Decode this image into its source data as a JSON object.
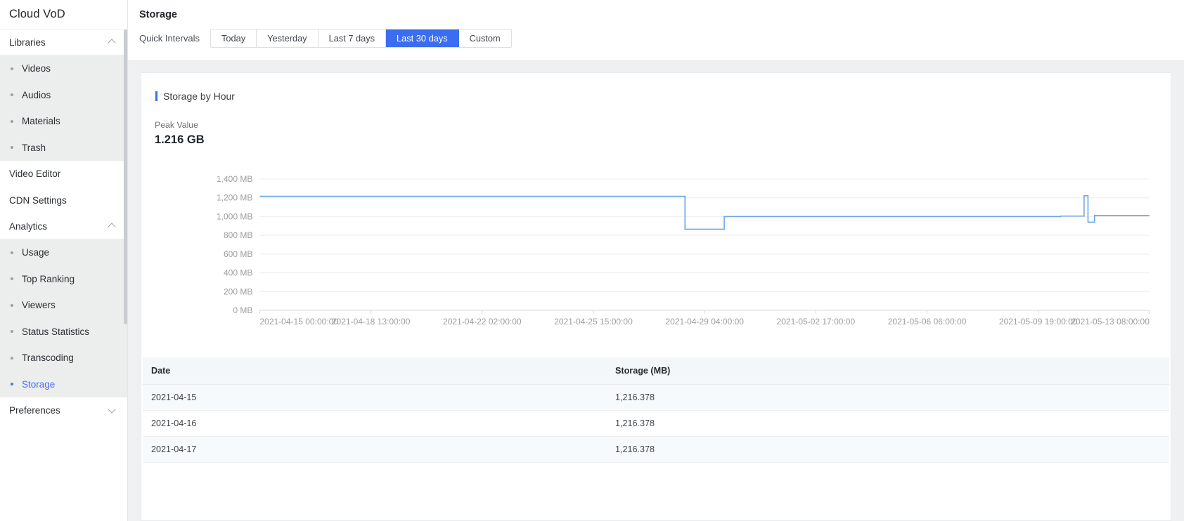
{
  "sidebar": {
    "brand": "Cloud VoD",
    "groups": [
      {
        "label": "Libraries",
        "icon": "chevron-up-icon",
        "expanded": true,
        "items": [
          {
            "label": "Videos",
            "active": false
          },
          {
            "label": "Audios",
            "active": false
          },
          {
            "label": "Materials",
            "active": false
          },
          {
            "label": "Trash",
            "active": false
          }
        ]
      }
    ],
    "plain_items": [
      {
        "label": "Video Editor"
      },
      {
        "label": "CDN Settings"
      }
    ],
    "analytics": {
      "label": "Analytics",
      "icon": "chevron-up-icon",
      "expanded": true,
      "items": [
        {
          "label": "Usage",
          "active": false
        },
        {
          "label": "Top Ranking",
          "active": false
        },
        {
          "label": "Viewers",
          "active": false
        },
        {
          "label": "Status Statistics",
          "active": false
        },
        {
          "label": "Transcoding",
          "active": false
        },
        {
          "label": "Storage",
          "active": true
        }
      ]
    },
    "preferences": {
      "label": "Preferences",
      "icon": "chevron-down-icon",
      "expanded": false
    }
  },
  "header": {
    "title": "Storage",
    "interval_label": "Quick Intervals",
    "intervals": [
      {
        "label": "Today",
        "active": false
      },
      {
        "label": "Yesterday",
        "active": false
      },
      {
        "label": "Last 7 days",
        "active": false
      },
      {
        "label": "Last 30 days",
        "active": true
      },
      {
        "label": "Custom",
        "active": false
      }
    ]
  },
  "card": {
    "title": "Storage by Hour",
    "peak_label": "Peak Value",
    "peak_value": "1.216 GB"
  },
  "colors": {
    "accent": "#3a6df0",
    "line": "#6ba5e8",
    "grid": "#ececec",
    "axis_text": "#9a9da1"
  },
  "chart_data": {
    "type": "line",
    "title": "Storage by Hour",
    "xlabel": "",
    "ylabel": "",
    "ylim": [
      0,
      1400
    ],
    "grid": true,
    "legend": "none",
    "y_ticks": [
      "0 MB",
      "200 MB",
      "400 MB",
      "600 MB",
      "800 MB",
      "1,000 MB",
      "1,200 MB",
      "1,400 MB"
    ],
    "y_tick_values": [
      0,
      200,
      400,
      600,
      800,
      1000,
      1200,
      1400
    ],
    "x_ticks": [
      "2021-04-15 00:00:00",
      "2021-04-18 13:00:00",
      "2021-04-22 02:00:00",
      "2021-04-25 15:00:00",
      "2021-04-29 04:00:00",
      "2021-05-02 17:00:00",
      "2021-05-06 06:00:00",
      "2021-05-09 19:00:00",
      "2021-05-13 08:00:00"
    ],
    "series": [
      {
        "name": "Storage",
        "unit": "MB",
        "points": [
          {
            "t": "2021-04-15 00:00:00",
            "v": 1216.378
          },
          {
            "t": "2021-04-28 12:00:00",
            "v": 1216.378
          },
          {
            "t": "2021-04-28 13:00:00",
            "v": 865
          },
          {
            "t": "2021-04-29 18:00:00",
            "v": 865
          },
          {
            "t": "2021-04-29 19:00:00",
            "v": 1000
          },
          {
            "t": "2021-05-09 00:00:00",
            "v": 1000
          },
          {
            "t": "2021-05-10 12:00:00",
            "v": 1005
          },
          {
            "t": "2021-05-11 06:00:00",
            "v": 1222
          },
          {
            "t": "2021-05-11 09:00:00",
            "v": 940
          },
          {
            "t": "2021-05-11 14:00:00",
            "v": 1012
          },
          {
            "t": "2021-05-13 08:00:00",
            "v": 1012
          }
        ]
      }
    ]
  },
  "table": {
    "columns": [
      "Date",
      "Storage (MB)"
    ],
    "rows": [
      {
        "date": "2021-04-15",
        "storage": "1,216.378"
      },
      {
        "date": "2021-04-16",
        "storage": "1,216.378"
      },
      {
        "date": "2021-04-17",
        "storage": "1,216.378"
      }
    ]
  }
}
